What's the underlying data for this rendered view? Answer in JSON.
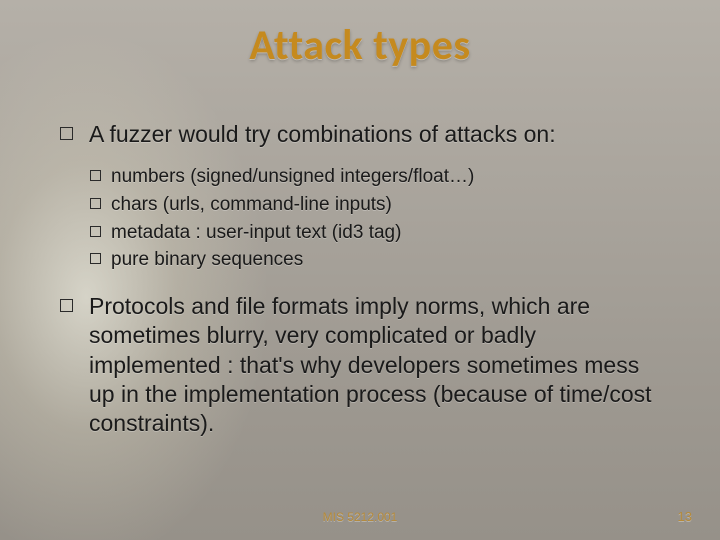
{
  "title": "Attack types",
  "bullets": [
    {
      "text": "A fuzzer would try combinations of attacks on:",
      "sub": [
        {
          "text": "numbers (signed/unsigned integers/float…)"
        },
        {
          "text": "chars (urls, command-line inputs)"
        },
        {
          "text": "metadata : user-input text (id3 tag)"
        },
        {
          "text": "pure binary sequences"
        }
      ]
    },
    {
      "text": "Protocols and file formats imply norms, which are sometimes blurry, very complicated or badly implemented : that's why developers sometimes mess up in the implementation process (because of time/cost constraints).",
      "sub": []
    }
  ],
  "footer": {
    "center": "MIS 5212.001",
    "page": "13"
  }
}
